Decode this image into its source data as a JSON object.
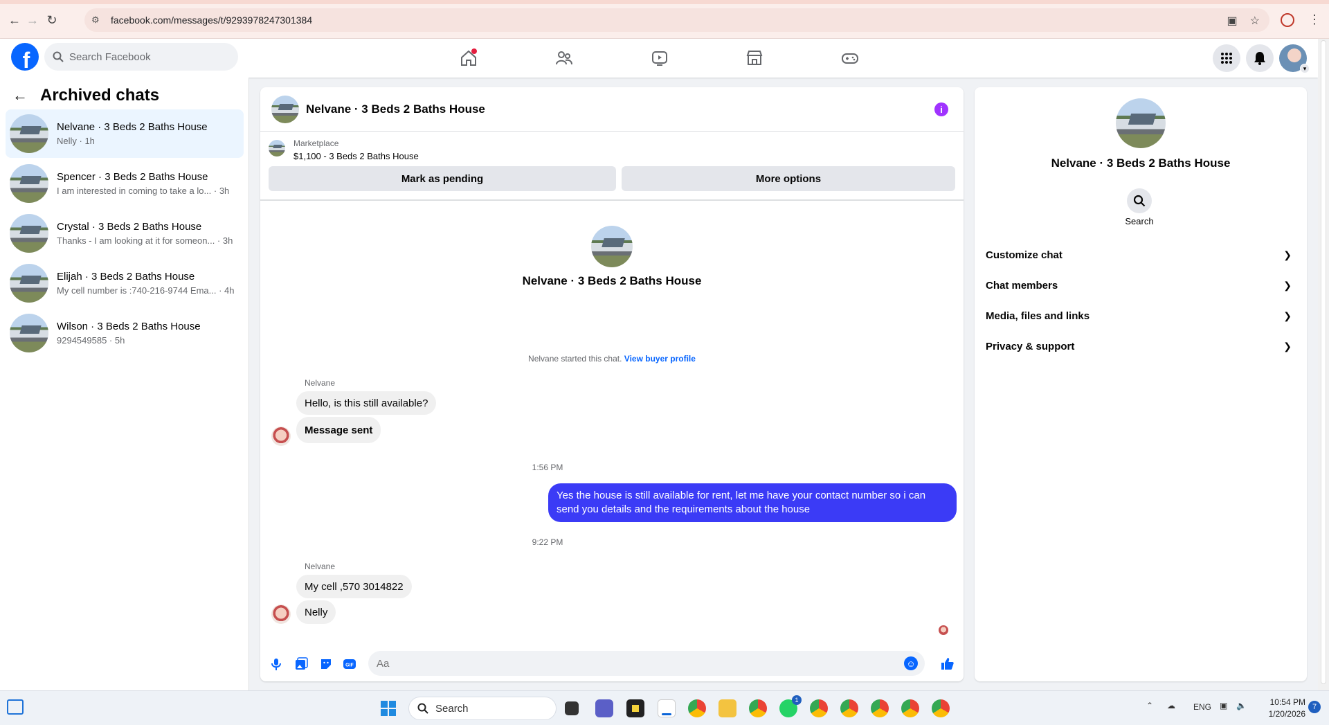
{
  "browser": {
    "url": "facebook.com/messages/t/9293978247301384"
  },
  "fb": {
    "search_placeholder": "Search Facebook",
    "logo_letter": "f"
  },
  "left": {
    "title": "Archived chats",
    "chats": [
      {
        "name": "Nelvane · 3 Beds 2 Baths House",
        "preview": "Nelly · 1h"
      },
      {
        "name": "Spencer · 3 Beds 2 Baths House",
        "preview": "I am interested in coming to take a lo... · 3h"
      },
      {
        "name": "Crystal · 3 Beds 2 Baths House",
        "preview": "Thanks - I am looking at it for someon... · 3h"
      },
      {
        "name": "Elijah · 3 Beds 2 Baths House",
        "preview": "My cell number is :740-216-9744 Ema... · 4h"
      },
      {
        "name": "Wilson · 3 Beds 2 Baths House",
        "preview": "9294549585 · 5h"
      }
    ]
  },
  "chat": {
    "title": "Nelvane · 3 Beds 2 Baths House",
    "marketplace_label": "Marketplace",
    "listing": "$1,100 - 3 Beds 2 Baths House",
    "mark_pending": "Mark as pending",
    "more_options": "More options",
    "header_name": "Nelvane · 3 Beds 2 Baths House",
    "started_text": "Nelvane started this chat.",
    "view_profile": "View buyer profile",
    "sender1": "Nelvane",
    "msg1": "Hello, is this still available?",
    "msg2": "Message sent",
    "time1": "1:56 PM",
    "msg_out": "Yes the house is still available for rent, let me have your contact number so i can send you details and the requirements about the house",
    "time2": "9:22 PM",
    "sender2": "Nelvane",
    "msg3": "My cell ,570 3014822",
    "msg4": "Nelly",
    "input_placeholder": "Aa",
    "gif_label": "GIF"
  },
  "right": {
    "title": "Nelvane · 3 Beds 2 Baths House",
    "search_label": "Search",
    "rows": [
      "Customize chat",
      "Chat members",
      "Media, files and links",
      "Privacy & support"
    ]
  },
  "taskbar": {
    "search_label": "Search",
    "lang": "ENG",
    "time": "10:54 PM",
    "date": "1/20/2026",
    "notif_count": "7",
    "whatsapp_badge": "1"
  },
  "colors": {
    "fb_blue": "#0866ff",
    "outgoing_bubble": "#3b3bf6",
    "info_purple": "#a033ff"
  }
}
